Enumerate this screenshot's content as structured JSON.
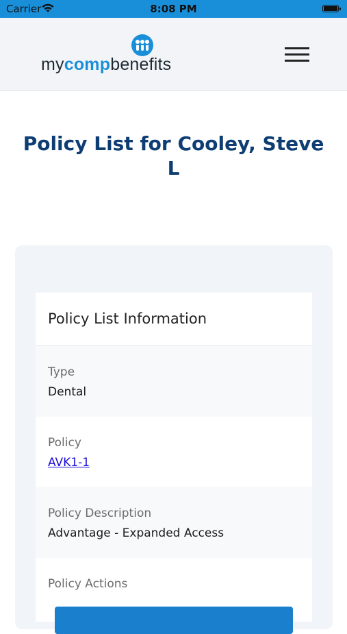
{
  "status_bar": {
    "carrier": "Carrier",
    "time": "8:08 PM"
  },
  "header": {
    "logo": {
      "prefix": "my",
      "accent": "comp",
      "suffix": "benefits"
    },
    "menu_icon": "hamburger-menu-icon"
  },
  "page": {
    "title": "Policy List for Cooley, Steve L"
  },
  "card": {
    "title": "Policy List Information",
    "fields": [
      {
        "label": "Type",
        "value": "Dental"
      },
      {
        "label": "Policy",
        "value": "AVK1-1"
      },
      {
        "label": "Policy Description",
        "value": "Advantage - Expanded Access"
      },
      {
        "label": "Policy Actions"
      }
    ]
  },
  "colors": {
    "brand_blue": "#1a8fd9",
    "title_navy": "#0d3d73",
    "link_blue": "#1a0dd8",
    "button_blue": "#1a7fcc"
  }
}
